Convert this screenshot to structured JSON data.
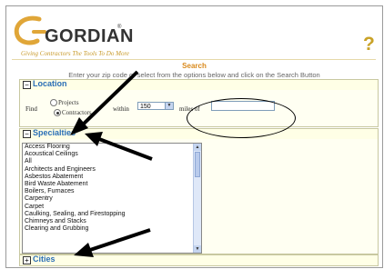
{
  "brand": {
    "name": "GORDIAN",
    "trademark": "®",
    "tagline": "Giving Contractors The Tools To Do More"
  },
  "help_glyph": "?",
  "search": {
    "title": "Search",
    "instructions": "Enter your zip code or select from the options below and click on the Search Button"
  },
  "location": {
    "title": "Location",
    "find_label": "Find",
    "options": [
      {
        "label": "Projects",
        "selected": false
      },
      {
        "label": "Contractors",
        "selected": true
      }
    ],
    "within_label": "within",
    "radius_value": "150",
    "miles_label": "miles of",
    "zip_value": ""
  },
  "specialties": {
    "title": "Specialties",
    "items": [
      "Access Flooring",
      "Acoustical Ceilings",
      "All",
      "Architects and Engineers",
      "Asbestos Abatement",
      "Bird Waste Abatement",
      "Boilers, Furnaces",
      "Carpentry",
      "Carpet",
      "Caulking, Sealing, and Firestopping",
      "Chimneys and Stacks",
      "Clearing and Grubbing"
    ]
  },
  "cities": {
    "title": "Cities"
  },
  "colors": {
    "brand_orange": "#d9891b",
    "panel_title_blue": "#2b6fb6",
    "panel_header_bg": "#ffffe6"
  },
  "icons": [
    "gordian-swoosh-logo",
    "help-question-icon",
    "collapse-icon",
    "expand-icon",
    "radio-icon",
    "dropdown-arrow-icon",
    "scroll-up-icon",
    "scroll-down-icon"
  ]
}
